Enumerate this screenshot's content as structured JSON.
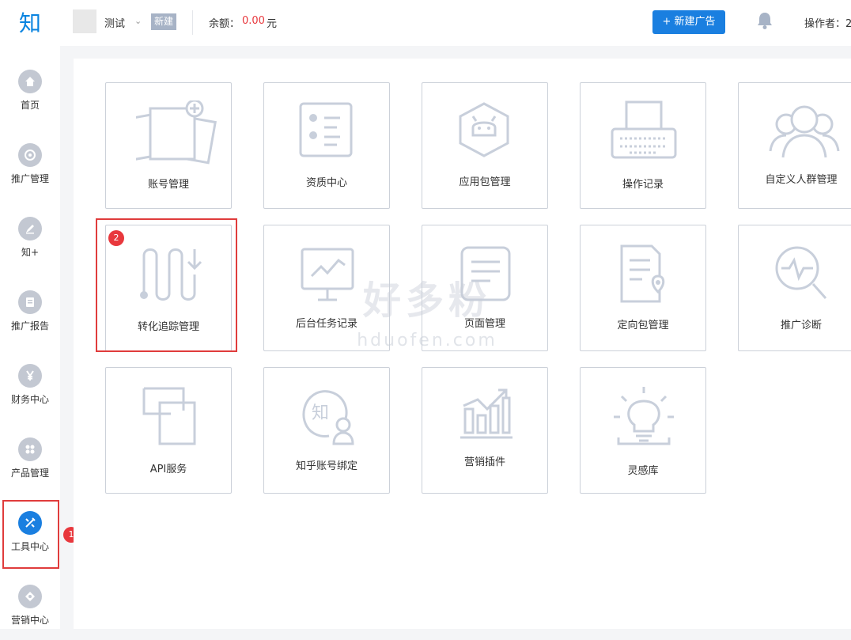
{
  "sidebar": {
    "logo": "知",
    "items": [
      {
        "label": "首页",
        "icon": "home-icon"
      },
      {
        "label": "推广管理",
        "icon": "promotion-icon"
      },
      {
        "label": "知+",
        "icon": "pen-icon"
      },
      {
        "label": "推广报告",
        "icon": "report-icon"
      },
      {
        "label": "财务中心",
        "icon": "yen-icon"
      },
      {
        "label": "产品管理",
        "icon": "grid-icon"
      },
      {
        "label": "工具中心",
        "icon": "tools-icon",
        "active": true
      },
      {
        "label": "营销中心",
        "icon": "marketing-icon"
      }
    ],
    "step_badge": "1"
  },
  "header": {
    "account_name": "测试",
    "new_tag": "新建",
    "balance_label": "余额：",
    "balance_value": "0.00",
    "balance_unit": "元",
    "new_ad_label": "+ 新建广告",
    "operator_label": "操作者：2"
  },
  "tools": {
    "step_badge": "2",
    "tiles": [
      {
        "label": "账号管理",
        "icon": "account-cards-icon"
      },
      {
        "label": "资质中心",
        "icon": "qualification-list-icon"
      },
      {
        "label": "应用包管理",
        "icon": "android-package-icon"
      },
      {
        "label": "操作记录",
        "icon": "typewriter-icon"
      },
      {
        "label": "自定义人群管理",
        "icon": "crowd-icon"
      },
      {
        "label": "转化追踪管理",
        "icon": "conversion-track-icon"
      },
      {
        "label": "后台任务记录",
        "icon": "monitor-chart-icon"
      },
      {
        "label": "页面管理",
        "icon": "page-icon"
      },
      {
        "label": "定向包管理",
        "icon": "document-location-icon"
      },
      {
        "label": "推广诊断",
        "icon": "diagnosis-search-icon"
      },
      {
        "label": "API服务",
        "icon": "api-squares-icon"
      },
      {
        "label": "知乎账号绑定",
        "icon": "zhihu-user-icon"
      },
      {
        "label": "营销插件",
        "icon": "bar-chart-arrow-icon"
      },
      {
        "label": "灵感库",
        "icon": "lightbulb-icon"
      }
    ]
  },
  "watermark": {
    "text": "好多粉",
    "url": "hduofen.com"
  },
  "colors": {
    "accent": "#1a7fe0",
    "danger": "#e8383d",
    "icon_gray": "#c8cfdb"
  }
}
